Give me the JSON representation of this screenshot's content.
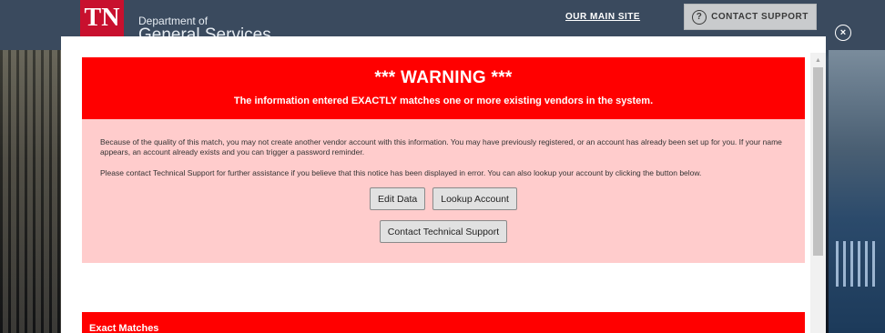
{
  "header": {
    "logo_text": "TN",
    "dept_line1": "Department of",
    "dept_line2": "General Services",
    "main_site_link": "OUR MAIN SITE",
    "contact_support_label": "CONTACT SUPPORT",
    "contact_support_icon": "?"
  },
  "modal": {
    "close_icon": "×",
    "warning": {
      "title": "*** WARNING ***",
      "subtitle": "The information entered EXACTLY matches one or more existing vendors in the system.",
      "paragraph1": "Because of the quality of this match, you may not create another vendor account with this information. You may have previously registered, or an account has already been set up for you. If your name appears, an account already exists and you can trigger a password reminder.",
      "paragraph2": "Please contact Technical Support for further assistance if you believe that this notice has been displayed in error. You can also lookup your account by clicking the button below.",
      "edit_data_label": "Edit Data",
      "lookup_account_label": "Lookup Account",
      "contact_tech_support_label": "Contact Technical Support"
    },
    "exact_matches_label": "Exact Matches"
  },
  "colors": {
    "warning_red": "#ff0000",
    "warning_body_bg": "#ffcccc",
    "tn_red": "#c8102e"
  }
}
